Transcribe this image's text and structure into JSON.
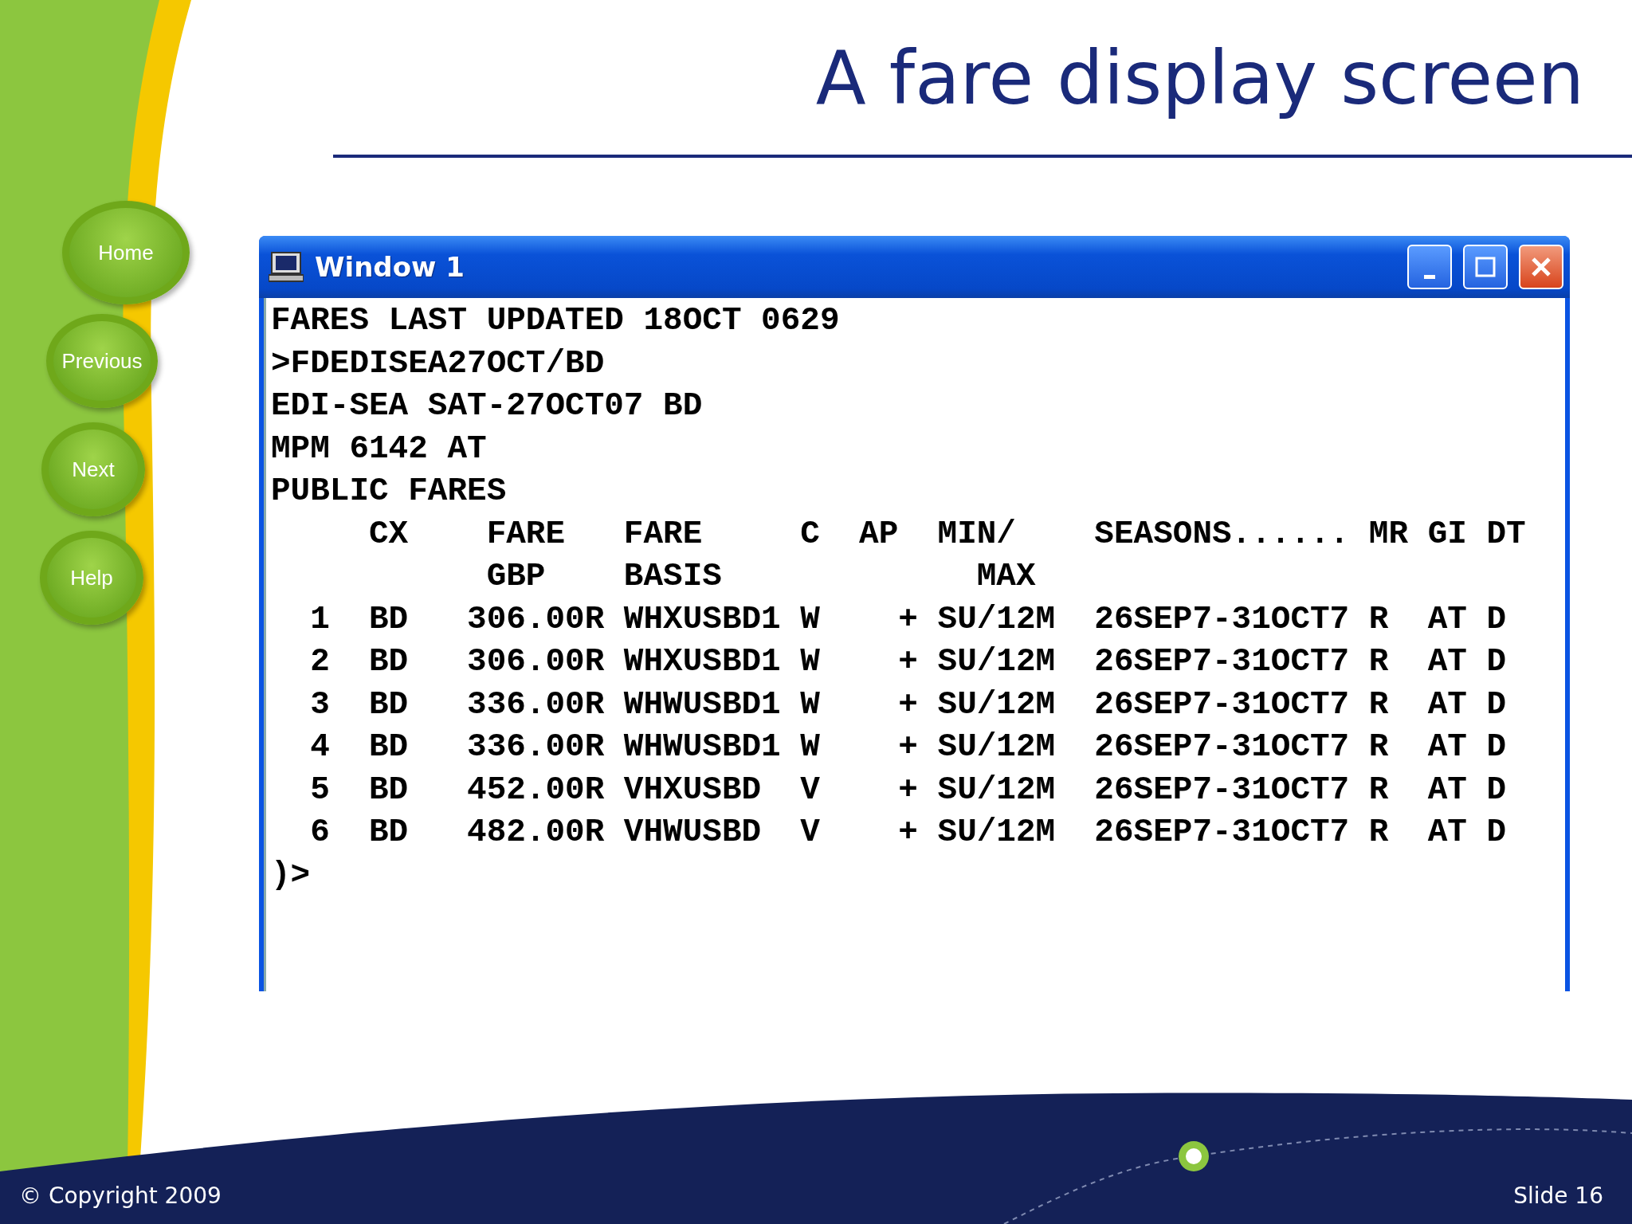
{
  "slide": {
    "title": "A fare display screen",
    "nav_buttons": [
      {
        "label": "Home"
      },
      {
        "label": "Previous"
      },
      {
        "label": "Next"
      },
      {
        "label": "Help"
      }
    ],
    "copyright": "© Copyright 2009",
    "slide_number": "Slide 16"
  },
  "window": {
    "title": "Window 1",
    "lines": [
      "FARES LAST UPDATED 18OCT 0629",
      ">FDEDISEA27OCT/BD",
      "EDI-SEA SAT-27OCT07 BD",
      "MPM 6142 AT",
      "PUBLIC FARES",
      "     CX    FARE   FARE     C  AP  MIN/    SEASONS...... MR GI DT",
      "           GBP    BASIS             MAX",
      "  1  BD   306.00R WHXUSBD1 W    + SU/12M  26SEP7-31OCT7 R  AT D",
      "  2  BD   306.00R WHXUSBD1 W    + SU/12M  26SEP7-31OCT7 R  AT D",
      "  3  BD   336.00R WHWUSBD1 W    + SU/12M  26SEP7-31OCT7 R  AT D",
      "  4  BD   336.00R WHWUSBD1 W    + SU/12M  26SEP7-31OCT7 R  AT D",
      "  5  BD   452.00R VHXUSBD  V    + SU/12M  26SEP7-31OCT7 R  AT D",
      "  6  BD   482.00R VHWUSBD  V    + SU/12M  26SEP7-31OCT7 R  AT D",
      ")>"
    ]
  }
}
